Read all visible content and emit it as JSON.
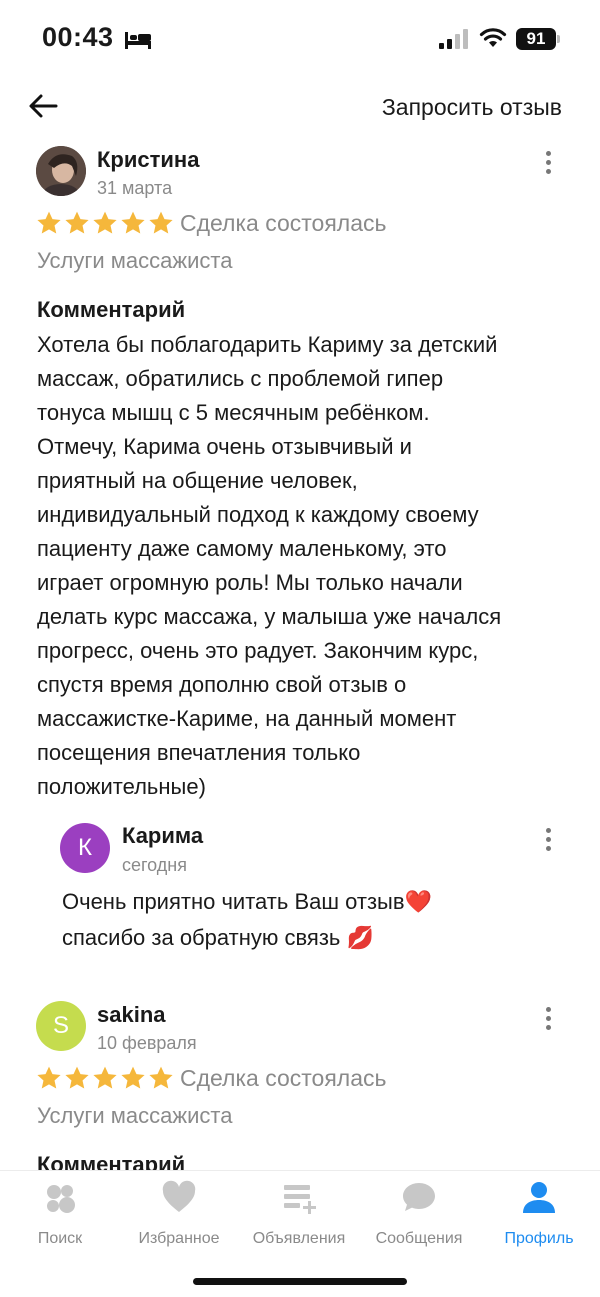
{
  "status_bar": {
    "time": "00:43",
    "battery": "91"
  },
  "header": {
    "request_review_label": "Запросить отзыв"
  },
  "reviews": [
    {
      "author": "Кристина",
      "date": "31 марта",
      "rating": 5,
      "deal_status": "Сделка состоялась",
      "service": "Услуги массажиста",
      "comment_heading": "Комментарий",
      "comment_lines": [
        "Хотела бы поблагодарить Кариму за детский",
        "массаж, обратились с проблемой гипер",
        "тонуса мышц с 5 месячным ребёнком.",
        "Отмечу, Карима очень отзывчивый и",
        "приятный на общение человек,",
        "индивидуальный подход к каждому своему",
        "пациенту даже самому маленькому, это",
        "играет огромную роль! Мы только начали",
        "делать курс массажа, у малыша уже начался",
        "прогресс, очень это радует. Закончим курс,",
        "спустя время дополню свой отзыв о",
        "массажистке-Кариме, на данный момент",
        "посещения впечатления только",
        "положительные)"
      ],
      "reply": {
        "avatar_letter": "К",
        "author": "Карима",
        "date": "сегодня",
        "text_line1": "Очень приятно читать Ваш отзыв❤️",
        "text_line2": "спасибо за обратную связь 💋"
      }
    },
    {
      "avatar_letter": "S",
      "author": "sakina",
      "date": "10 февраля",
      "rating": 5,
      "deal_status": "Сделка состоялась",
      "service": "Услуги массажиста",
      "comment_heading": "Комментарий"
    }
  ],
  "tabs": [
    {
      "label": "Поиск",
      "icon": "search-icon",
      "active": false
    },
    {
      "label": "Избранное",
      "icon": "heart-icon",
      "active": false
    },
    {
      "label": "Объявления",
      "icon": "listings-icon",
      "active": false
    },
    {
      "label": "Сообщения",
      "icon": "chat-icon",
      "active": false
    },
    {
      "label": "Профиль",
      "icon": "profile-icon",
      "active": true
    }
  ],
  "colors": {
    "star": "#F5B73B",
    "active_tab": "#1E8CF0",
    "inactive_tab": "#C7C7C7",
    "reply_avatar": "#9B3FC0",
    "sakina_avatar": "#C5DC4E",
    "secondary_text": "#8A8A8A"
  }
}
